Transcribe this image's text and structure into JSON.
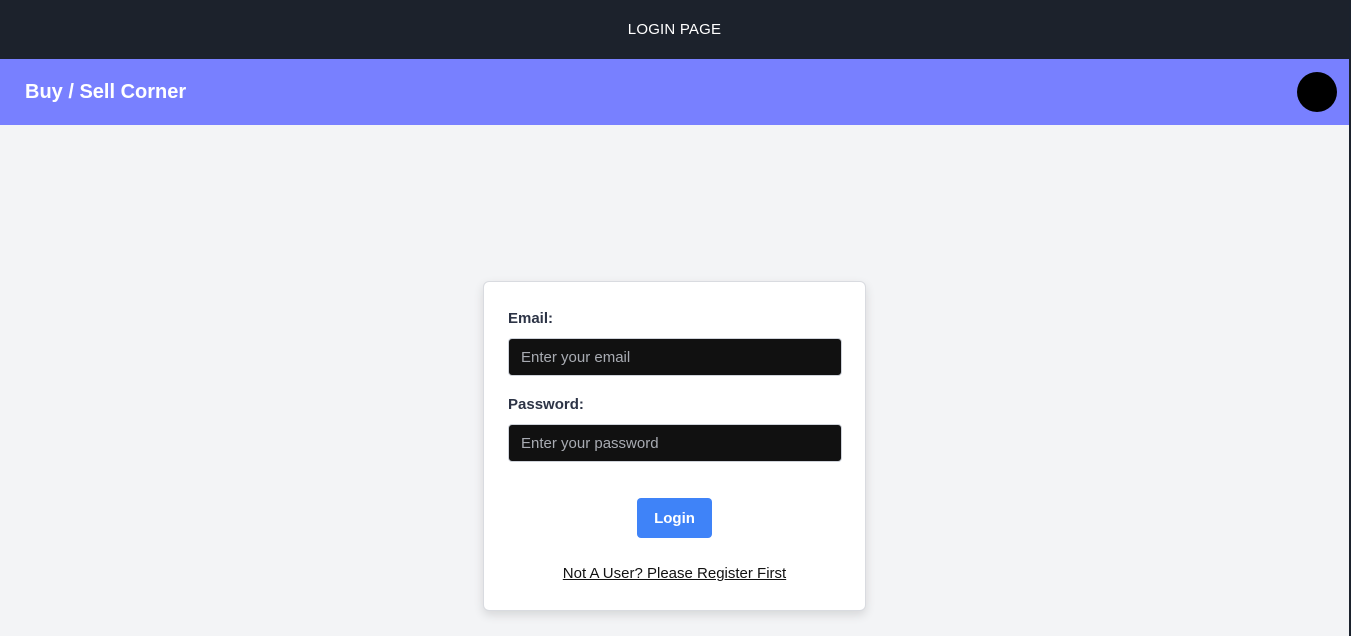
{
  "topbar": {
    "title": "LOGIN PAGE"
  },
  "navbar": {
    "brand": "Buy / Sell Corner"
  },
  "login_form": {
    "email_label": "Email:",
    "email_placeholder": "Enter your email",
    "email_value": "",
    "password_label": "Password:",
    "password_placeholder": "Enter your password",
    "password_value": "",
    "submit_label": "Login",
    "register_link": "Not A User? Please Register First"
  },
  "colors": {
    "topbar_bg": "#1c222c",
    "navbar_bg": "#7880ff",
    "page_bg": "#f3f4f6",
    "input_bg": "#111111",
    "button_bg": "#3f83f8"
  }
}
